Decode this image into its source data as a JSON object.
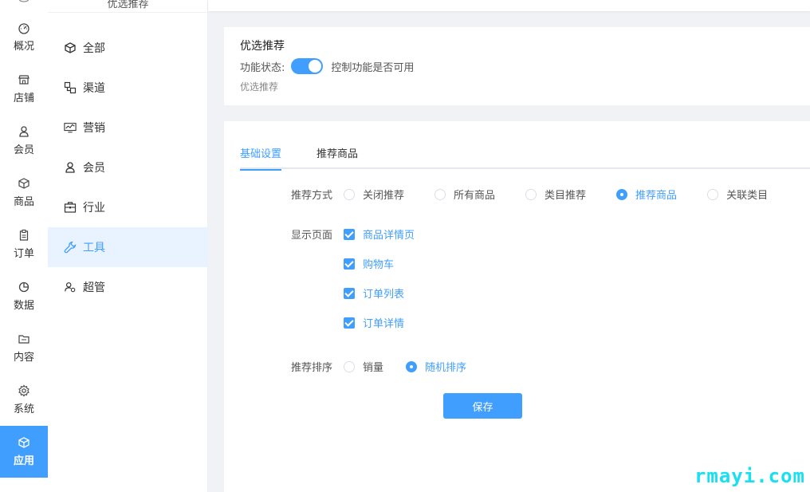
{
  "rail": {
    "items": [
      {
        "label": "概况",
        "icon": "dashboard-icon"
      },
      {
        "label": "店铺",
        "icon": "shop-icon"
      },
      {
        "label": "会员",
        "icon": "user-icon"
      },
      {
        "label": "商品",
        "icon": "box-icon"
      },
      {
        "label": "订单",
        "icon": "clipboard-icon"
      },
      {
        "label": "数据",
        "icon": "pie-chart-icon"
      },
      {
        "label": "内容",
        "icon": "folder-icon"
      },
      {
        "label": "系统",
        "icon": "gear-icon"
      },
      {
        "label": "应用",
        "icon": "box-icon",
        "active": true
      }
    ]
  },
  "submenu": {
    "title": "优选推荐",
    "items": [
      {
        "label": "全部",
        "icon": "box-icon"
      },
      {
        "label": "渠道",
        "icon": "channel-icon"
      },
      {
        "label": "营销",
        "icon": "monitor-chart-icon"
      },
      {
        "label": "会员",
        "icon": "user-icon"
      },
      {
        "label": "行业",
        "icon": "briefcase-icon"
      },
      {
        "label": "工具",
        "icon": "wrench-icon",
        "active": true
      },
      {
        "label": "超管",
        "icon": "admin-icon"
      }
    ]
  },
  "feature": {
    "title": "优选推荐",
    "status_label": "功能状态:",
    "switch_on": true,
    "switch_desc": "控制功能是否可用",
    "subtitle": "优选推荐"
  },
  "tabs": [
    {
      "label": "基础设置",
      "active": true
    },
    {
      "label": "推荐商品",
      "active": false
    }
  ],
  "form": {
    "method_label": "推荐方式",
    "methods": [
      {
        "label": "关闭推荐",
        "checked": false
      },
      {
        "label": "所有商品",
        "checked": false
      },
      {
        "label": "类目推荐",
        "checked": false
      },
      {
        "label": "推荐商品",
        "checked": true
      },
      {
        "label": "关联类目",
        "checked": false
      }
    ],
    "pages_label": "显示页面",
    "pages": [
      {
        "label": "商品详情页",
        "checked": true
      },
      {
        "label": "购物车",
        "checked": true
      },
      {
        "label": "订单列表",
        "checked": true
      },
      {
        "label": "订单详情",
        "checked": true
      }
    ],
    "sort_label": "推荐排序",
    "sorts": [
      {
        "label": "销量",
        "checked": false
      },
      {
        "label": "随机排序",
        "checked": true
      }
    ],
    "save_label": "保存"
  },
  "watermark": "rmayi.com",
  "colors": {
    "accent": "#409eff",
    "active_bg": "#e8f3ff",
    "watermark": "#18e0f0"
  }
}
